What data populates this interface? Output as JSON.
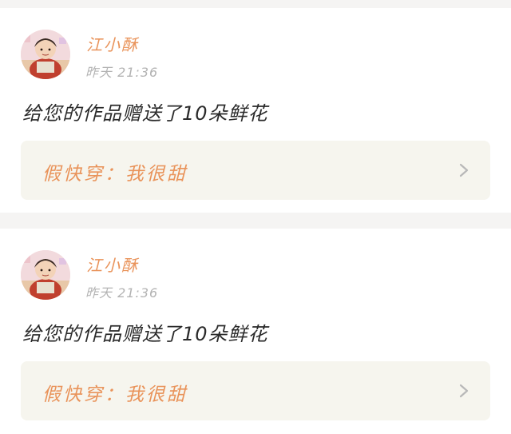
{
  "posts": [
    {
      "username": "江小酥",
      "timestamp": "昨天 21:36",
      "message": "给您的作品赠送了10朵鲜花",
      "work_title": "假快穿：我很甜"
    },
    {
      "username": "江小酥",
      "timestamp": "昨天 21:36",
      "message": "给您的作品赠送了10朵鲜花",
      "work_title": "假快穿：我很甜"
    }
  ],
  "colors": {
    "accent": "#e9935a",
    "link_background": "#f6f5ee",
    "page_background": "#f5f4f3",
    "timestamp": "#b3b3b3"
  },
  "icons": {
    "link_arrow": "chevron-right-icon"
  }
}
